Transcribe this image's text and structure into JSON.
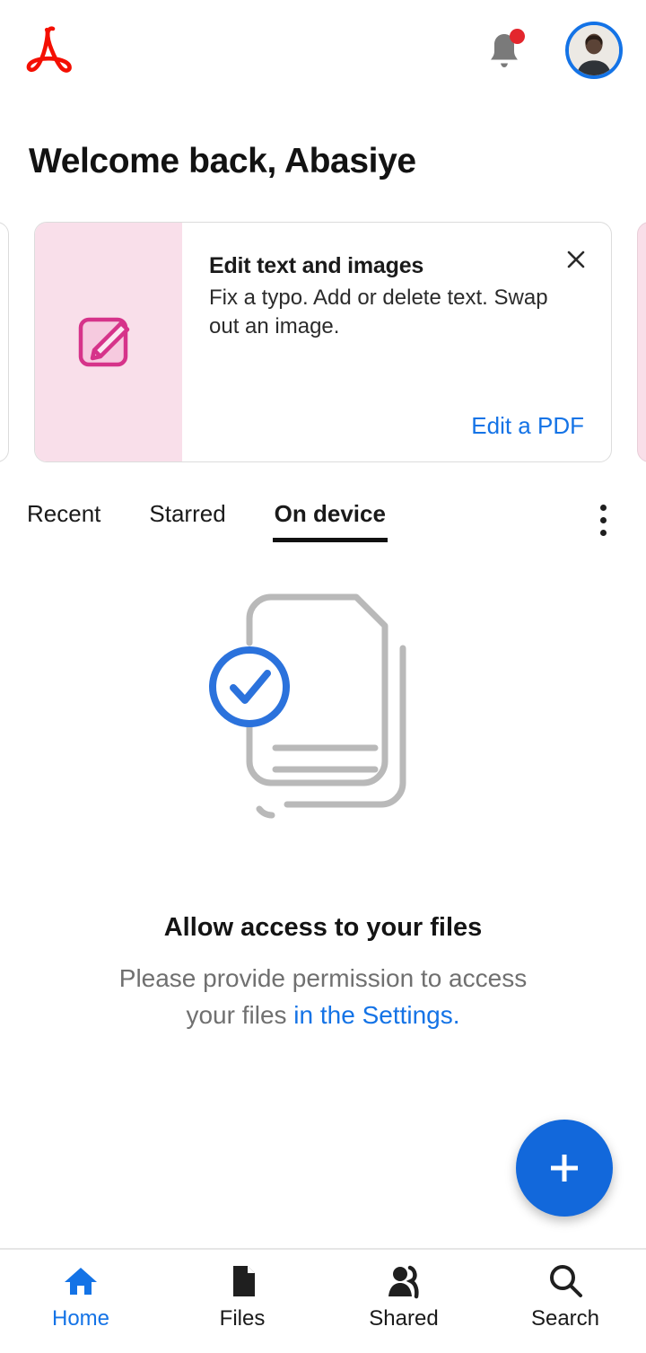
{
  "app": {
    "name": "Adobe Acrobat",
    "logo_icon": "acrobat-logo"
  },
  "header": {
    "notifications": {
      "icon": "bell-icon",
      "has_unread": true,
      "badge_color": "#E3262D"
    },
    "avatar": {
      "icon": "avatar",
      "ring_color": "#1473E6"
    }
  },
  "welcome": {
    "greeting": "Welcome back, Abasiye",
    "user_name": "Abasiye"
  },
  "promo": {
    "thumb_icon": "edit-pencil-icon",
    "thumb_bg": "#F9DFEA",
    "title": "Edit text and images",
    "description": "Fix a typo. Add or delete text. Swap out an image.",
    "cta_label": "Edit a PDF",
    "cta_color": "#1473E6",
    "close_icon": "close-icon"
  },
  "tabs": {
    "items": [
      {
        "label": "Recent",
        "active": false
      },
      {
        "label": "Starred",
        "active": false
      },
      {
        "label": "On device",
        "active": true
      }
    ],
    "overflow_icon": "more-vertical-icon"
  },
  "empty_state": {
    "illustration_icon": "documents-check-illustration",
    "title": "Allow access to your files",
    "description_prefix": "Please provide permission to access your files ",
    "description_link": "in the Settings.",
    "link_color": "#1473E6"
  },
  "fab": {
    "icon": "plus-icon",
    "label": "+",
    "color": "#1268DB"
  },
  "bottom_nav": {
    "items": [
      {
        "label": "Home",
        "icon": "home-icon",
        "active": true
      },
      {
        "label": "Files",
        "icon": "file-icon",
        "active": false
      },
      {
        "label": "Shared",
        "icon": "people-icon",
        "active": false
      },
      {
        "label": "Search",
        "icon": "search-icon",
        "active": false
      }
    ],
    "active_color": "#1473E6"
  }
}
